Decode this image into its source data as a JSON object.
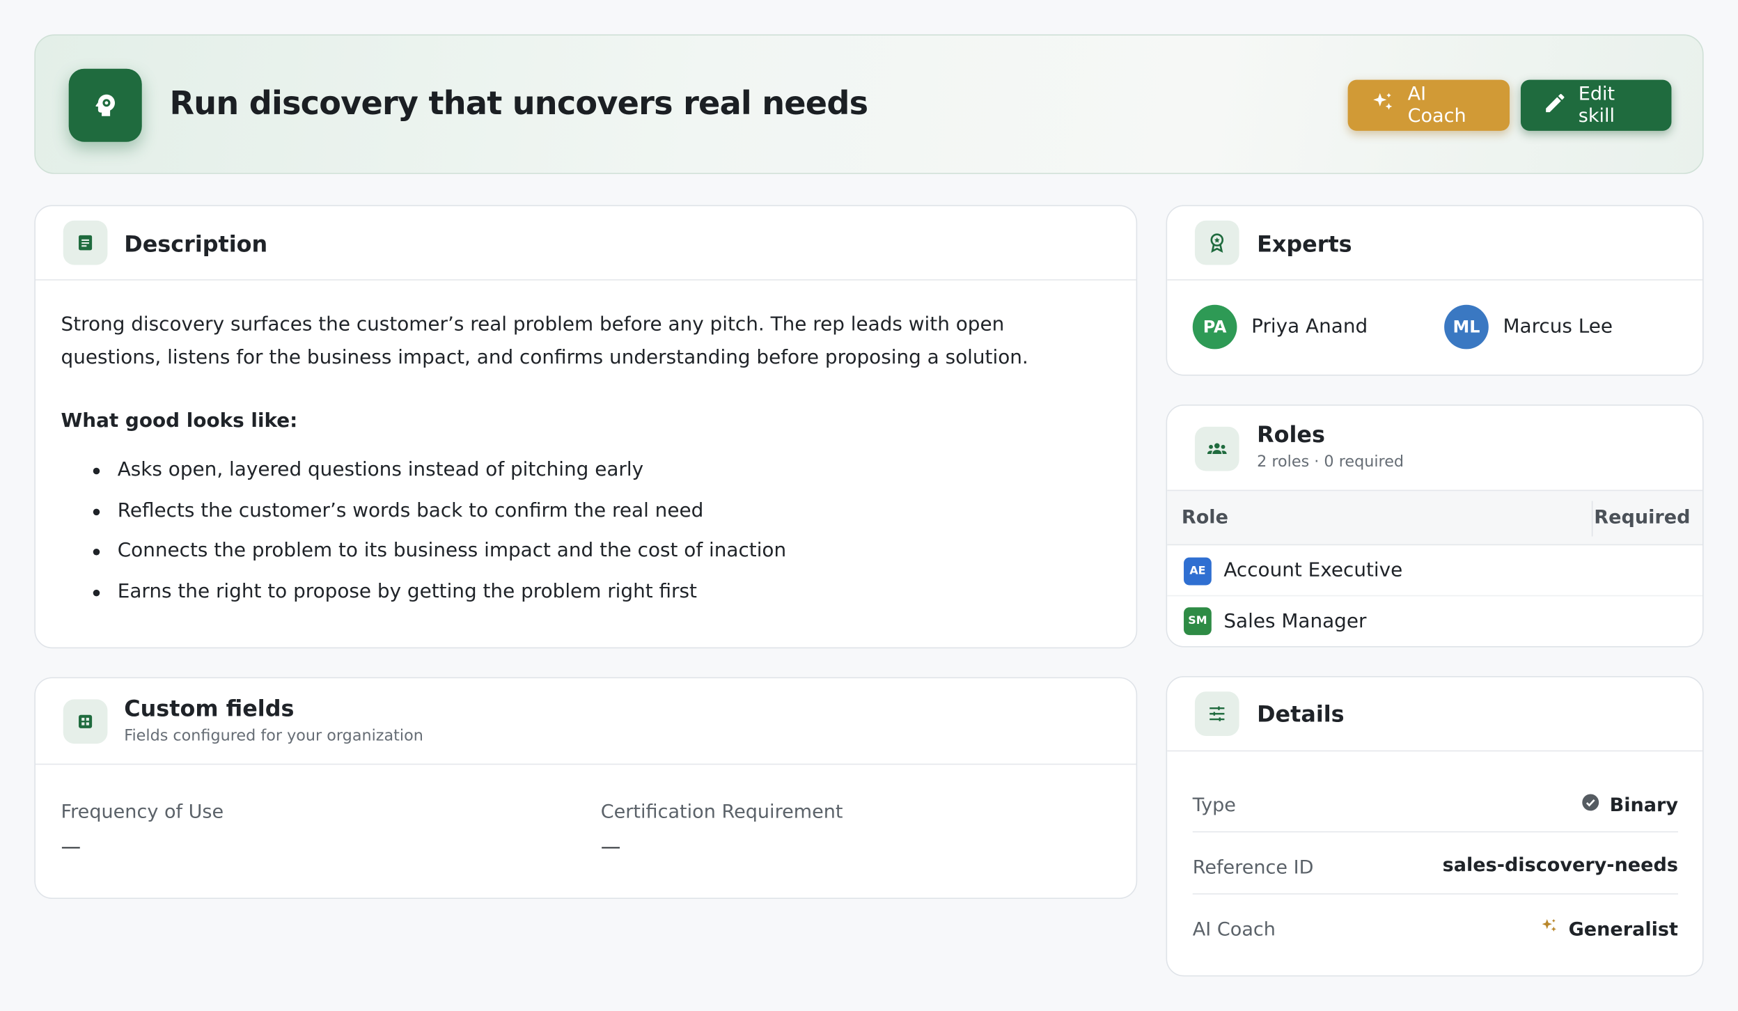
{
  "header": {
    "title": "Run discovery that uncovers real needs",
    "ai_coach_label": "AI Coach",
    "edit_label": "Edit skill"
  },
  "description": {
    "title": "Description",
    "text": "Strong discovery surfaces the customer’s real problem before any pitch. The rep leads with open questions, listens for the business impact, and confirms understanding before proposing a solution.",
    "good_title": "What good looks like:",
    "bullets": [
      "Asks open, layered questions instead of pitching early",
      "Reflects the customer’s words back to confirm the real need",
      "Connects the problem to its business impact and the cost of inaction",
      "Earns the right to propose by getting the problem right first"
    ]
  },
  "custom_fields": {
    "title": "Custom fields",
    "subtitle": "Fields configured for your organization",
    "fields": [
      {
        "label": "Frequency of Use",
        "value": "—"
      },
      {
        "label": "Certification Requirement",
        "value": "—"
      }
    ]
  },
  "experts": {
    "title": "Experts",
    "people": [
      {
        "initials": "PA",
        "name": "Priya Anand",
        "color": "#2e9a55"
      },
      {
        "initials": "ML",
        "name": "Marcus Lee",
        "color": "#3a78c2"
      }
    ]
  },
  "roles": {
    "title": "Roles",
    "subtitle": "2 roles · 0 required",
    "col_role": "Role",
    "col_required": "Required",
    "rows": [
      {
        "badge": "AE",
        "name": "Account Executive",
        "color": "#2f6fd1"
      },
      {
        "badge": "SM",
        "name": "Sales Manager",
        "color": "#2e8b45"
      }
    ]
  },
  "details": {
    "title": "Details",
    "rows": [
      {
        "label": "Type",
        "value": "Binary",
        "icon": "check-circle-icon"
      },
      {
        "label": "Reference ID",
        "value": "sales-discovery-needs"
      },
      {
        "label": "AI Coach",
        "value": "Generalist",
        "icon": "sparkle-icon"
      }
    ]
  },
  "colors": {
    "brand_green": "#1f6b3e",
    "coach_gold": "#d19a36"
  }
}
